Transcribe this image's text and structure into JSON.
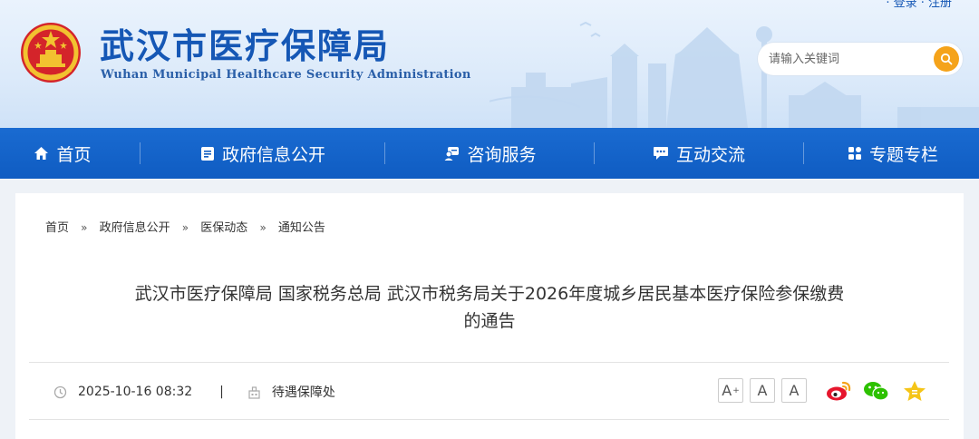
{
  "header": {
    "title": "武汉市医疗保障局",
    "subtitle": "Wuhan Municipal Healthcare Security Administration",
    "top_links": "· 登录 · 注册"
  },
  "search": {
    "placeholder": "请输入关键词",
    "icon": "search-icon"
  },
  "nav": {
    "items": [
      {
        "label": "首页",
        "icon": "home-icon"
      },
      {
        "label": "政府信息公开",
        "icon": "document-icon"
      },
      {
        "label": "咨询服务",
        "icon": "consult-icon"
      },
      {
        "label": "互动交流",
        "icon": "chat-icon"
      },
      {
        "label": "专题专栏",
        "icon": "grid-icon"
      }
    ]
  },
  "breadcrumb": [
    "首页",
    "政府信息公开",
    "医保动态",
    "通知公告"
  ],
  "breadcrumb_separator": "»",
  "article": {
    "title_line1": "武汉市医疗保障局 国家税务总局 武汉市税务局关于2026年度城乡居民基本医疗保险参保缴费",
    "title_line2": "的通告",
    "date": "2025-10-16 08:32",
    "meta_separator": "|",
    "source": "待遇保障处"
  },
  "font_controls": {
    "large": "A",
    "large_sup": "+",
    "medium": "A",
    "small": "A"
  },
  "share": [
    "weibo-icon",
    "wechat-icon",
    "favorite-star-icon"
  ],
  "colors": {
    "brand_blue": "#1557b5",
    "nav_blue": "#0f5cc2",
    "accent_orange": "#f5a31a"
  }
}
